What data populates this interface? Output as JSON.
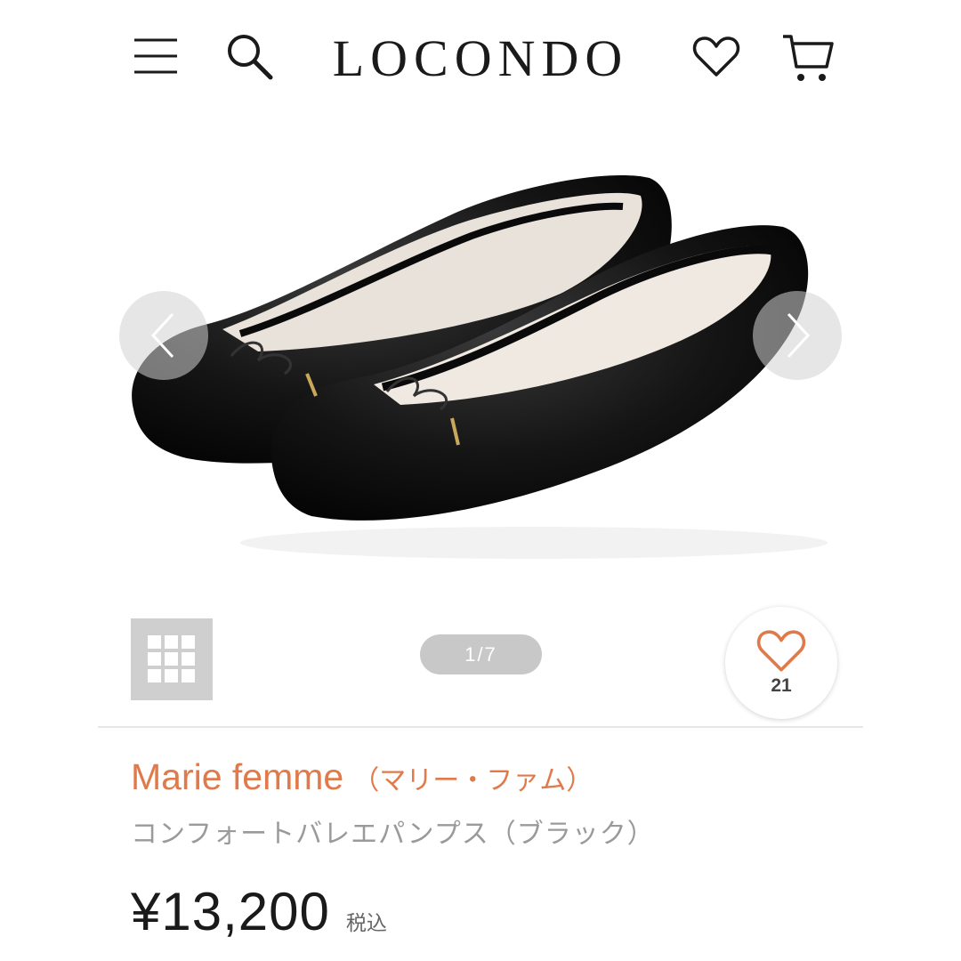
{
  "header": {
    "logo": "LOCONDO",
    "icons": [
      "menu-icon",
      "search-icon",
      "heart-icon",
      "cart-icon"
    ]
  },
  "carousel": {
    "counter": "1/7",
    "image": "black-ballet-flats-photo"
  },
  "favorite": {
    "count": "21",
    "color": "#e07a4a"
  },
  "product": {
    "brand": "Marie femme",
    "brand_kana": "（マリー・ファム）",
    "name": "コンフォートバレエパンプス（ブラック）",
    "price": "¥13,200",
    "tax_label": "税込"
  },
  "colors": {
    "accent": "#e07a4a",
    "muted_text": "#9a9a9a"
  }
}
